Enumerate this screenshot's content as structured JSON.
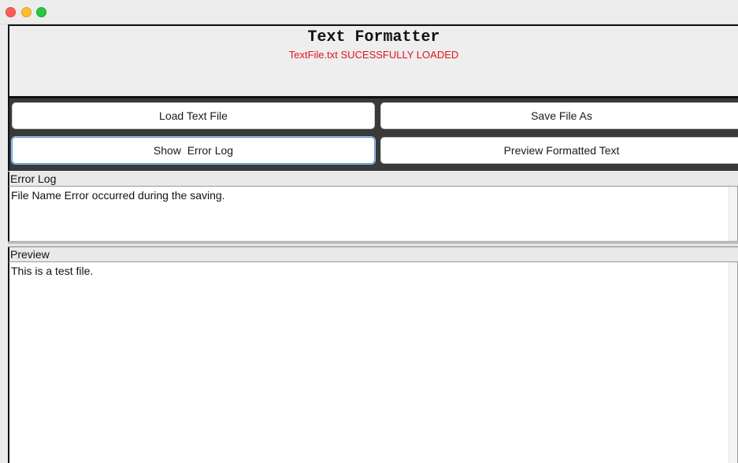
{
  "window": {
    "controls": [
      "close",
      "minimize",
      "maximize"
    ]
  },
  "header": {
    "title": "Text Formatter",
    "status": "TextFile.txt SUCESSFULLY LOADED",
    "status_color": "#e0151c"
  },
  "buttons": {
    "load": "Load Text File",
    "save": "Save File As",
    "show_error_log": "Show  Error Log",
    "preview": "Preview Formatted Text"
  },
  "error_log": {
    "label": "Error Log",
    "content": "File Name Error occurred during the saving."
  },
  "preview": {
    "label": "Preview",
    "content": "This is a test file."
  }
}
